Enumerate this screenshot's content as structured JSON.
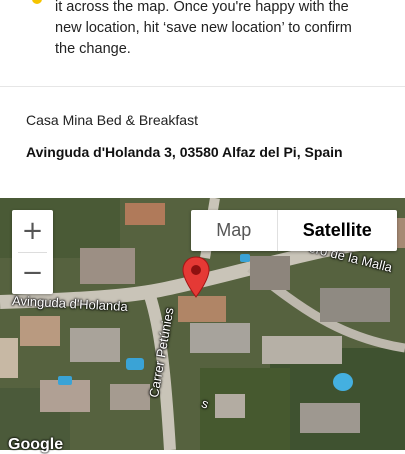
{
  "instructions": {
    "line1": "it across the map. Once you're happy with the",
    "line2": "new location, hit ‘save new location’ to confirm",
    "line3": "the change."
  },
  "property": {
    "name": "Casa Mina Bed & Breakfast",
    "address": "Avinguda d'Holanda 3, 03580 Alfaz del Pi, Spain"
  },
  "map": {
    "zoom_in_label": "+",
    "zoom_out_label": "−",
    "map_type": {
      "map_label": "Map",
      "satellite_label": "Satellite",
      "selected": "Satellite"
    },
    "road_labels": {
      "holanda": "Avinguda d'Holanda",
      "malla": "ero de la Malla",
      "petunies": "Carrer Petúnies",
      "top_fragment": "s"
    },
    "attribution": "Google",
    "pin_icon": "map-pin-icon",
    "pin_color": "#e53935"
  }
}
